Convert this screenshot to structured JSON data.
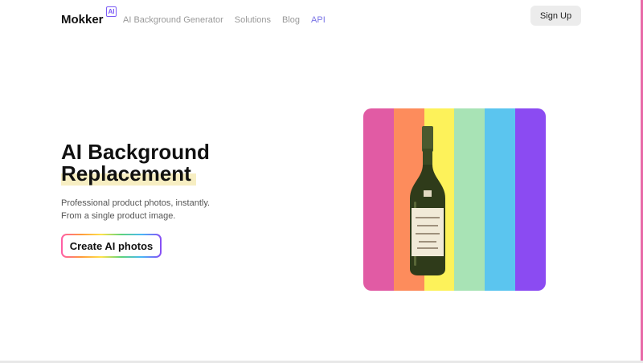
{
  "header": {
    "logo_text": "Mokker",
    "logo_badge": "AI",
    "nav": [
      {
        "label": "AI Background Generator"
      },
      {
        "label": "Solutions"
      },
      {
        "label": "Blog"
      },
      {
        "label": "API"
      }
    ],
    "signup_label": "Sign Up"
  },
  "hero": {
    "title_line1": "AI Background",
    "title_line2": "Replacement",
    "subtitle_line1": "Professional product photos, instantly.",
    "subtitle_line2": "From a single product image.",
    "cta_label": "Create AI photos"
  },
  "product_image": {
    "stripe_colors": [
      "#e15ba4",
      "#fd8c5c",
      "#fdf25a",
      "#a8e3b5",
      "#5bc5ef",
      "#8b4bf2"
    ]
  },
  "colors": {
    "accent": "#7a74e6",
    "highlight": "#f7eec2"
  }
}
